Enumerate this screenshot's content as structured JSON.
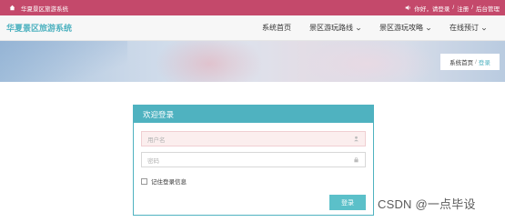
{
  "topbar": {
    "site_name": "华夏景区旅游系统",
    "greeting": "你好，请登录",
    "register": "注册",
    "admin": "后台管理",
    "separator": "/"
  },
  "navbar": {
    "brand": "华夏景区旅游系统",
    "items": [
      {
        "label": "系统首页",
        "has_dropdown": false
      },
      {
        "label": "景区游玩路线",
        "has_dropdown": true
      },
      {
        "label": "景区游玩攻略",
        "has_dropdown": true
      },
      {
        "label": "在线预订",
        "has_dropdown": true
      }
    ]
  },
  "breadcrumb": {
    "home": "系统首页",
    "separator": "/",
    "current": "登录"
  },
  "login": {
    "title": "欢迎登录",
    "username_placeholder": "用户名",
    "password_placeholder": "密码",
    "remember_label": "记住登录信息",
    "submit_label": "登录"
  },
  "watermark": "CSDN @一点毕设",
  "colors": {
    "topbar": "#c4496b",
    "accent": "#4fb2c0",
    "button": "#5bc0c9"
  }
}
